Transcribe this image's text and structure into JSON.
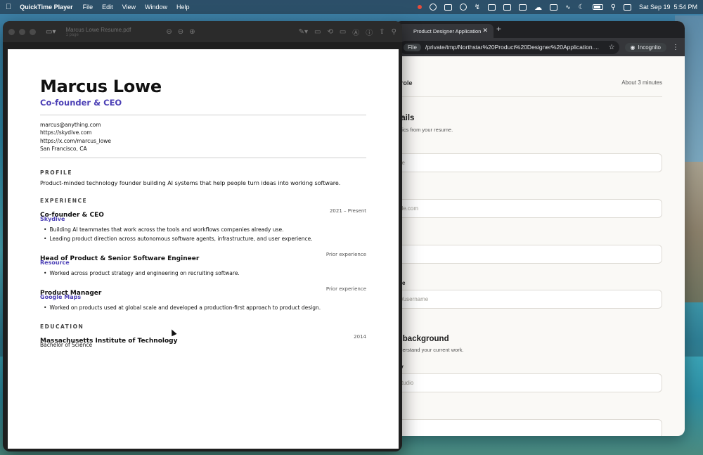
{
  "menubar": {
    "app_name": "QuickTime Player",
    "menus": [
      "File",
      "Edit",
      "View",
      "Window",
      "Help"
    ],
    "clock": "Sat Sep 19  5:54 PM",
    "status_icons": [
      "record-icon",
      "cloud-icon",
      "bars-icon",
      "s-icon",
      "bolt-icon",
      "box-icon",
      "dot-icon",
      "square-icon",
      "cloud-flare-icon",
      "display-icon",
      "wifi-icon",
      "moon-icon",
      "battery-icon",
      "search-icon",
      "control-center-icon"
    ]
  },
  "pdf_window": {
    "title": "Marcus Lowe Resume.pdf",
    "pages": "1 page"
  },
  "resume": {
    "name": "Marcus Lowe",
    "role": "Co-founder & CEO",
    "contact": [
      "marcus@anything.com",
      "https://skydive.com",
      "https://x.com/marcus_lowe",
      "San Francisco, CA"
    ],
    "profile_heading": "PROFILE",
    "profile_text": "Product-minded technology founder building AI systems that help people turn ideas into working software.",
    "experience_heading": "EXPERIENCE",
    "jobs": [
      {
        "title": "Co-founder & CEO",
        "date": "2021 – Present",
        "company": "Skydive",
        "bullets": [
          "Building AI teammates that work across the tools and workflows companies already use.",
          "Leading product direction across autonomous software agents, infrastructure, and user experience."
        ]
      },
      {
        "title": "Head of Product & Senior Software Engineer",
        "date": "Prior experience",
        "company": "Resource",
        "bullets": [
          "Worked across product strategy and engineering on recruiting software."
        ]
      },
      {
        "title": "Product Manager",
        "date": "Prior experience",
        "company": "Google Maps",
        "bullets": [
          "Worked on products used at global scale and developed a production-first approach to product design."
        ]
      }
    ],
    "education_heading": "EDUCATION",
    "school": "Massachusetts Institute of Technology",
    "school_year": "2014",
    "degree": "Bachelor of Science"
  },
  "browser": {
    "tab_title": "Product Designer Application",
    "omni_scheme": "File",
    "url": "/private/tmp/Northstar%20Product%20Designer%20Application....",
    "incognito": "Incognito",
    "header_left": "is role",
    "header_right": "About 3 minutes",
    "section1_title": "etails",
    "section1_sub": "basics from your resume.",
    "field1_placeholder": "ne",
    "field2_label": "s",
    "field2_placeholder": "ple.com",
    "field3_label": "on",
    "field4_label": "ofile",
    "field4_placeholder": "n/username",
    "section2_title": "al background",
    "section2_sub": " understand your current work.",
    "field5_label": "any",
    "field5_placeholder": " studio"
  }
}
